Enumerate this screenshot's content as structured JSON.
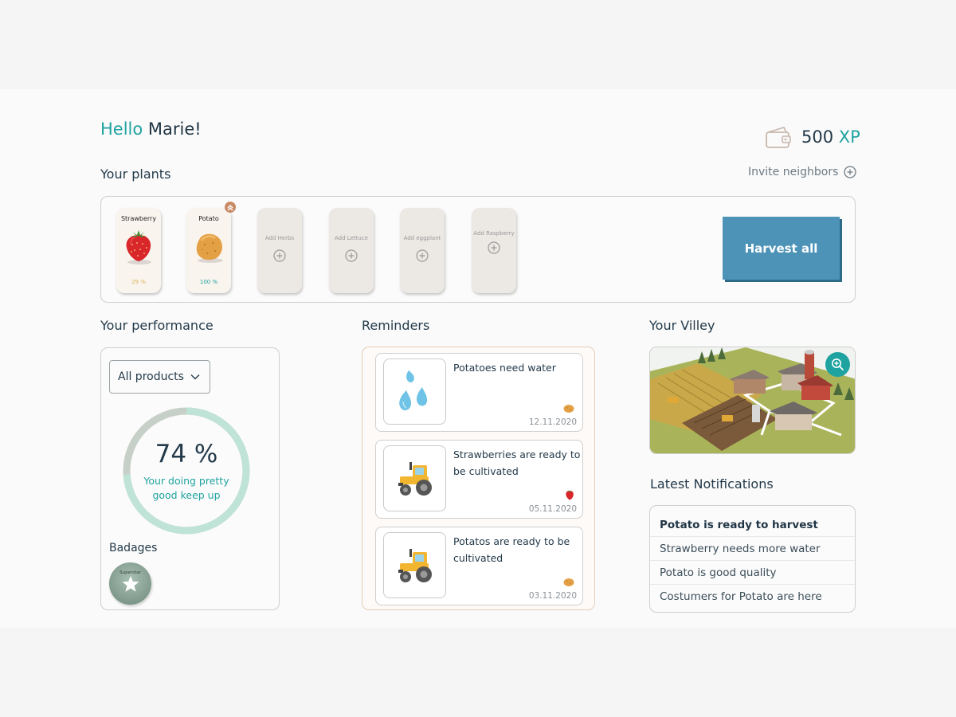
{
  "header": {
    "greeting": "Hello",
    "user_name": "Marie!",
    "xp_value": "500",
    "xp_unit": "XP"
  },
  "plants_section": {
    "title": "Your plants",
    "invite_label": "Invite neighbors",
    "plants": [
      {
        "name": "Strawberry",
        "progress": "29 %",
        "progress_value": 29
      },
      {
        "name": "Potato",
        "progress": "100 %",
        "progress_value": 100
      }
    ],
    "add_slots": [
      "Add Herbs",
      "Add Lettuce",
      "Add eggplant",
      "Add Raspberry"
    ],
    "harvest_button": "Harvest all"
  },
  "performance": {
    "title": "Your performance",
    "filter_value": "All products",
    "percent_label": "74 %",
    "percent_value": 74,
    "message": "Your doing pretty good keep up",
    "badges_title": "Badages",
    "badge_name": "Superstar"
  },
  "reminders": {
    "title": "Reminders",
    "items": [
      {
        "text": "Potatoes need water",
        "date": "12.11.2020",
        "icon": "water-drops-icon",
        "crop_icon": "potato-icon"
      },
      {
        "text": "Strawberries are ready to be cultivated",
        "date": "05.11.2020",
        "icon": "tractor-icon",
        "crop_icon": "strawberry-icon"
      },
      {
        "text": "Potatos are ready to be cultivated",
        "date": "03.11.2020",
        "icon": "tractor-icon",
        "crop_icon": "potato-icon"
      }
    ]
  },
  "village": {
    "title": "Your Villey"
  },
  "notifications": {
    "title": "Latest Notifications",
    "items": [
      "Potato is ready to harvest",
      "Strawberry needs more water",
      "Potato is good quality",
      "Costumers for Potato are here"
    ]
  },
  "colors": {
    "accent": "#1fa3a0",
    "harvest_button": "#4d93b8",
    "text_dark": "#233a4a"
  }
}
